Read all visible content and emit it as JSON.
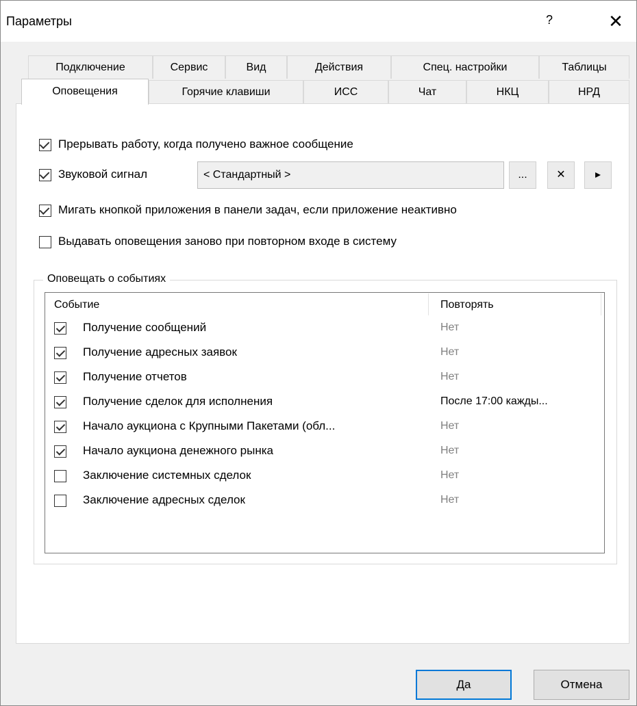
{
  "window": {
    "title": "Параметры",
    "help_glyph": "?",
    "close_glyph": "✕"
  },
  "tabs_row1": [
    "Подключение",
    "Сервис",
    "Вид",
    "Действия",
    "Спец. настройки",
    "Таблицы"
  ],
  "tabs_row2": [
    "Оповещения",
    "Горячие клавиши",
    "ИСС",
    "Чат",
    "НКЦ",
    "НРД"
  ],
  "active_tab": "Оповещения",
  "options": {
    "interrupt": {
      "label": "Прерывать работу, когда получено важное сообщение",
      "checked": true
    },
    "sound": {
      "label": "Звуковой сигнал",
      "checked": true,
      "value": "< Стандартный >"
    },
    "flash": {
      "label": "Мигать кнопкой приложения в панели задач, если приложение неактивно",
      "checked": true
    },
    "renotify": {
      "label": "Выдавать оповещения заново при повторном входе в систему",
      "checked": false
    }
  },
  "sound_buttons": {
    "browse": "...",
    "clear": "✕",
    "play": "▸"
  },
  "group": {
    "title": "Оповещать о событиях",
    "columns": {
      "event": "Событие",
      "repeat": "Повторять"
    },
    "rows": [
      {
        "checked": true,
        "name": "Получение сообщений",
        "repeat": "Нет"
      },
      {
        "checked": true,
        "name": "Получение адресных заявок",
        "repeat": "Нет"
      },
      {
        "checked": true,
        "name": "Получение отчетов",
        "repeat": "Нет"
      },
      {
        "checked": true,
        "name": "Получение сделок для исполнения",
        "repeat": "После 17:00 кажды..."
      },
      {
        "checked": true,
        "name": "Начало аукциона с Крупными Пакетами (обл...",
        "repeat": "Нет"
      },
      {
        "checked": true,
        "name": "Начало аукциона денежного рынка",
        "repeat": "Нет"
      },
      {
        "checked": false,
        "name": "Заключение системных сделок",
        "repeat": "Нет"
      },
      {
        "checked": false,
        "name": "Заключение адресных сделок",
        "repeat": "Нет"
      }
    ]
  },
  "buttons": {
    "ok": "Да",
    "cancel": "Отмена"
  }
}
